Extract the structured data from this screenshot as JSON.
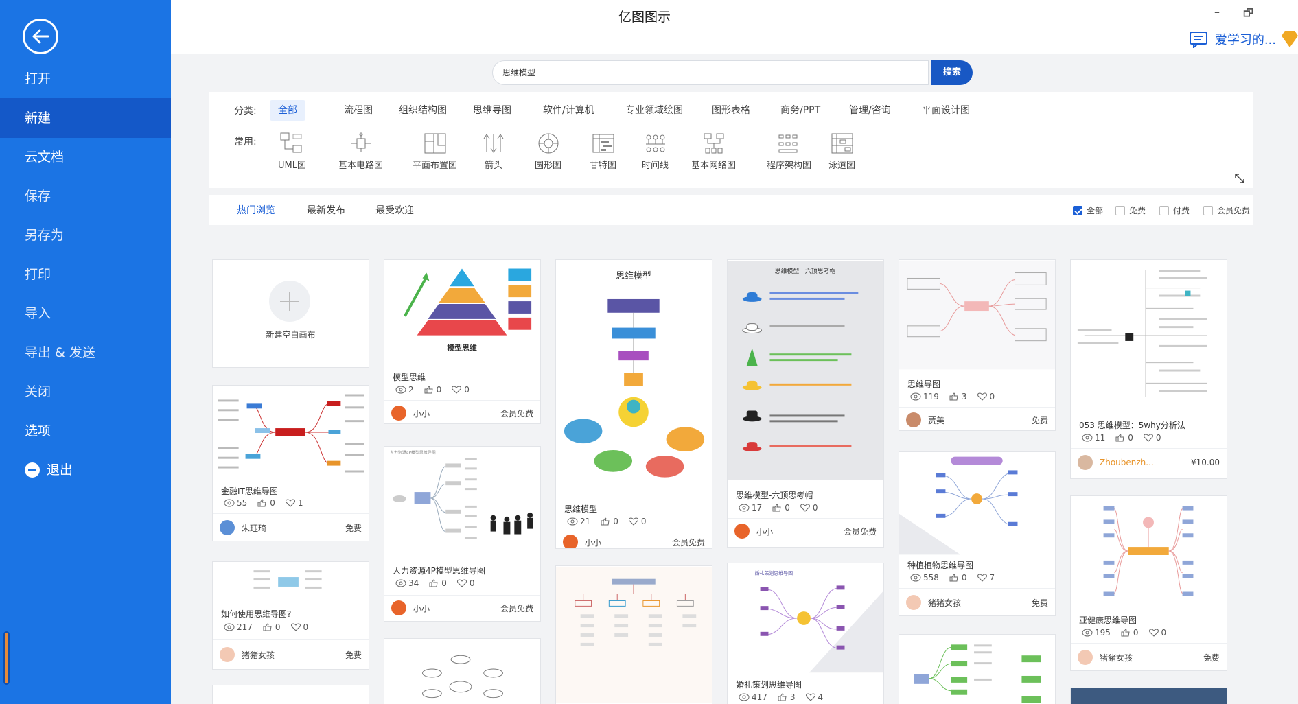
{
  "app": {
    "title": "亿图图示",
    "user_name": "爱学习的...",
    "window_controls": {
      "minimize": "–",
      "restore": "🗗"
    }
  },
  "sidebar": {
    "items": [
      {
        "label": "打开"
      },
      {
        "label": "新建"
      },
      {
        "label": "云文档"
      },
      {
        "label": "保存"
      },
      {
        "label": "另存为"
      },
      {
        "label": "打印"
      },
      {
        "label": "导入"
      },
      {
        "label": "导出 & 发送"
      },
      {
        "label": "关闭"
      },
      {
        "label": "选项"
      },
      {
        "label": "退出"
      }
    ]
  },
  "search": {
    "value": "思维模型",
    "button_label": "搜索"
  },
  "categories": {
    "label": "分类:",
    "items": [
      "全部",
      "流程图",
      "组织结构图",
      "思维导图",
      "软件/计算机",
      "专业领域绘图",
      "图形表格",
      "商务/PPT",
      "管理/咨询",
      "平面设计图"
    ]
  },
  "common": {
    "label": "常用:",
    "items": [
      "UML图",
      "基本电路图",
      "平面布置图",
      "箭头",
      "圆形图",
      "甘特图",
      "时间线",
      "基本网络图",
      "程序架构图",
      "泳道图"
    ]
  },
  "sort": {
    "tabs": [
      "热门浏览",
      "最新发布",
      "最受欢迎"
    ],
    "filters": [
      "全部",
      "免费",
      "付费",
      "会员免费"
    ]
  },
  "new_blank": {
    "label": "新建空白画布"
  },
  "cards": [
    {
      "title": "金融IT思维导图",
      "views": "55",
      "likes": "0",
      "favs": "1",
      "author": "朱珏琦",
      "price": "免费"
    },
    {
      "title": "如何使用思维导图?",
      "views": "217",
      "likes": "0",
      "favs": "0",
      "author": "猪猪女孩",
      "price": "免费"
    },
    {
      "title": "模型思维",
      "views": "2",
      "likes": "0",
      "favs": "0",
      "author": "小小",
      "price": "会员免费",
      "thumb_title": "模型思维"
    },
    {
      "title": "人力资源4P模型思维导图",
      "views": "34",
      "likes": "0",
      "favs": "0",
      "author": "小小",
      "price": "会员免费"
    },
    {
      "title": "思维模型",
      "views": "21",
      "likes": "0",
      "favs": "0",
      "author": "小小",
      "price": "会员免费",
      "thumb_title": "思维模型"
    },
    {
      "title": "思维模型-六顶思考帽",
      "views": "17",
      "likes": "0",
      "favs": "0",
      "author": "小小",
      "price": "会员免费",
      "thumb_title": "思维模型 · 六顶思考帽"
    },
    {
      "title": "婚礼策划思维导图",
      "views": "417",
      "likes": "3",
      "favs": "4"
    },
    {
      "title": "思维导图",
      "views": "119",
      "likes": "3",
      "favs": "0",
      "author": "贾美",
      "price": "免费"
    },
    {
      "title": "种植植物思维导图",
      "views": "558",
      "likes": "0",
      "favs": "7",
      "author": "猪猪女孩",
      "price": "免费"
    },
    {
      "title": "053 思维模型：5why分析法",
      "views": "11",
      "likes": "0",
      "favs": "0",
      "author": "Zhoubenzh...",
      "price": "¥10.00"
    },
    {
      "title": "亚健康思维导图",
      "views": "195",
      "likes": "0",
      "favs": "0",
      "author": "猪猪女孩",
      "price": "免费"
    }
  ],
  "colors": {
    "sidebar": "#1b74e4",
    "sidebar_active": "#1458c8",
    "accent": "#1b5fd6",
    "search_button": "#1858c4"
  }
}
